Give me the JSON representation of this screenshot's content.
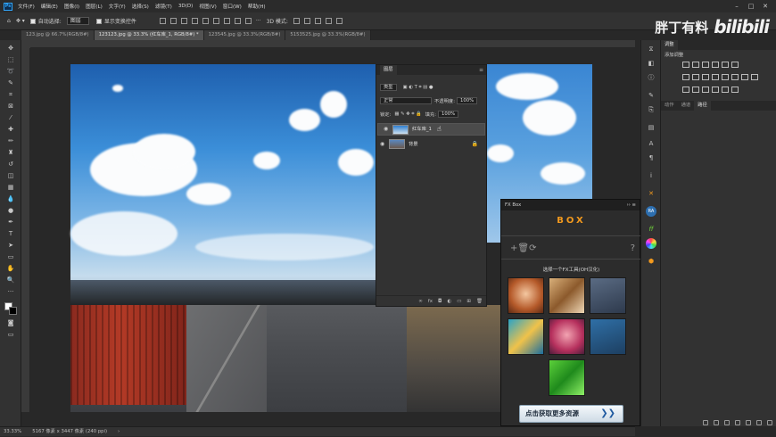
{
  "menu": {
    "logo": "Ps",
    "items": [
      "文件(F)",
      "编辑(E)",
      "图像(I)",
      "图层(L)",
      "文字(Y)",
      "选择(S)",
      "滤镜(T)",
      "3D(D)",
      "视图(V)",
      "窗口(W)",
      "帮助(H)"
    ],
    "window_controls": [
      "–",
      "□",
      "✕"
    ]
  },
  "options": {
    "auto_select_label": "自动选择:",
    "auto_select_value": "图层",
    "show_transform_label": "显示变换控件",
    "mode_3d_label": "3D 模式:"
  },
  "watermark": {
    "text": "胖丁有料",
    "brand": "bilibili"
  },
  "doc_tabs": [
    "123.jpg @ 66.7%(RGB/8#)",
    "123123.jpg @ 33.3% (红车库_1, RGB/8#) *",
    "123545.jpg @ 33.3%(RGB/8#)",
    "5153525.jpg @ 33.3%(RGB/8#)"
  ],
  "status": {
    "zoom": "33.33%",
    "doc_info": "5167 像素 x 3447 像素 (240 ppi)"
  },
  "layers_panel": {
    "tab": "图层",
    "kind_label": "类型",
    "blend_mode": "正常",
    "opacity_label": "不透明度:",
    "opacity_value": "100%",
    "lock_label": "锁定:",
    "fill_label": "填充:",
    "fill_value": "100%",
    "layers": [
      {
        "name": "红车库_1",
        "selected": true
      },
      {
        "name": "背景",
        "selected": false
      }
    ],
    "footer_icons": [
      "link-icon",
      "fx-icon",
      "mask-icon",
      "adjustment-icon",
      "folder-icon",
      "new-layer-icon",
      "trash-icon"
    ]
  },
  "right_panel": {
    "tabs_top": [
      "调整"
    ],
    "adjust_title": "添加调整",
    "tabs_bottom": [
      "动作",
      "通道",
      "路径"
    ]
  },
  "fxbox": {
    "title": "FX Box",
    "logo": "BOX",
    "prompt": "选择一个FX工具(OH汉化)",
    "cta": "点击获取更多资源",
    "tiles": [
      "portrait-warm",
      "wolf-lowpoly",
      "3d-box",
      "sunglasses-pop",
      "portrait-pink",
      "3d-box-teal",
      "3d-box-green"
    ]
  },
  "colors": {
    "accent": "#31a8ff",
    "fx_orange": "#f39a1e"
  }
}
